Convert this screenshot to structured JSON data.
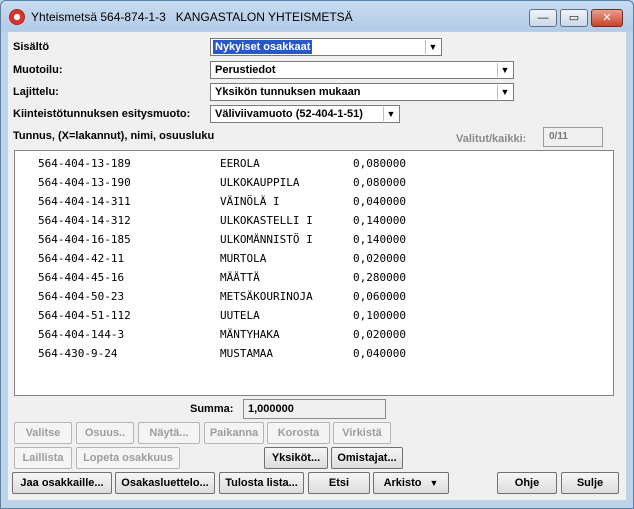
{
  "window": {
    "title": "Yhteismetsä 564-874-1-3   KANGASTALON YHTEISMETSÄ",
    "minimize": "—",
    "maximize": "▭",
    "close": "✕"
  },
  "form": {
    "sisalto": {
      "label": "Sisältö",
      "value": "Nykyiset osakkaat"
    },
    "muotoilu": {
      "label": "Muotoilu:",
      "value": "Perustiedot"
    },
    "lajittelu": {
      "label": "Lajittelu:",
      "value": "Yksikön tunnuksen mukaan"
    },
    "esitysmuoto": {
      "label": "Kiinteistötunnuksen esitysmuoto:",
      "value": "Väliviivamuoto (52-404-1-51)"
    }
  },
  "list_header": "Tunnus, (X=lakannut), nimi, osuusluku",
  "selected_label": "Valitut/kaikki:",
  "selected_value": "0/11",
  "rows": [
    {
      "tunnus": "564-404-13-189",
      "nimi": "EEROLA",
      "osuus": "0,080000"
    },
    {
      "tunnus": "564-404-13-190",
      "nimi": "ULKOKAUPPILA",
      "osuus": "0,080000"
    },
    {
      "tunnus": "564-404-14-311",
      "nimi": "VÄINÖLÄ I",
      "osuus": "0,040000"
    },
    {
      "tunnus": "564-404-14-312",
      "nimi": "ULKOKASTELLI I",
      "osuus": "0,140000"
    },
    {
      "tunnus": "564-404-16-185",
      "nimi": "ULKOMÄNNISTÖ I",
      "osuus": "0,140000"
    },
    {
      "tunnus": "564-404-42-11",
      "nimi": "MURTOLA",
      "osuus": "0,020000"
    },
    {
      "tunnus": "564-404-45-16",
      "nimi": "MÄÄTTÄ",
      "osuus": "0,280000"
    },
    {
      "tunnus": "564-404-50-23",
      "nimi": "METSÄKOURINOJA",
      "osuus": "0,060000"
    },
    {
      "tunnus": "564-404-51-112",
      "nimi": "UUTELA",
      "osuus": "0,100000"
    },
    {
      "tunnus": "564-404-144-3",
      "nimi": "MÄNTYHAKA",
      "osuus": "0,020000"
    },
    {
      "tunnus": "564-430-9-24",
      "nimi": "MUSTAMAA",
      "osuus": "0,040000"
    }
  ],
  "summa": {
    "label": "Summa:",
    "value": "1,000000"
  },
  "buttons": {
    "valitse": "Valitse",
    "osuus": "Osuus..",
    "nayta": "Näytä...",
    "paikanna": "Paikanna",
    "korosta": "Korosta",
    "virkista": "Virkistä",
    "laillista": "Laillista",
    "lopeta": "Lopeta osakkuus",
    "yksikot": "Yksiköt...",
    "omistajat": "Omistajat...",
    "jaa": "Jaa osakkaille...",
    "osakasluettelo": "Osakasluettelo...",
    "tulosta": "Tulosta lista...",
    "etsi": "Etsi",
    "arkisto": "Arkisto",
    "ohje": "Ohje",
    "sulje": "Sulje"
  }
}
